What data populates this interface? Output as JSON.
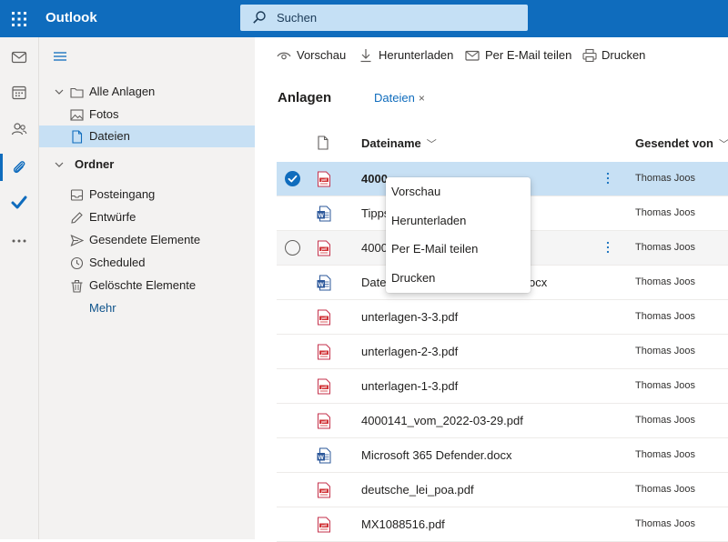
{
  "app": {
    "brand": "Outlook",
    "search_placeholder": "Suchen",
    "accent": "#0f6cbd"
  },
  "rail": {
    "icons": [
      "mail-icon",
      "calendar-icon",
      "people-icon",
      "attachment-icon",
      "todo-check-icon",
      "more-dots-icon"
    ],
    "active": "attachment-icon"
  },
  "folders": {
    "all_attachments": "Alle Anlagen",
    "photos": "Fotos",
    "files": "Dateien",
    "folders_header": "Ordner",
    "inbox": "Posteingang",
    "drafts": "Entwürfe",
    "sent": "Gesendete Elemente",
    "scheduled": "Scheduled",
    "deleted": "Gelöschte Elemente",
    "more": "Mehr"
  },
  "toolbar": {
    "preview": "Vorschau",
    "download": "Herunterladen",
    "share_email": "Per E-Mail teilen",
    "print": "Drucken"
  },
  "main": {
    "title": "Anlagen",
    "filter_chip": "Dateien",
    "filter_chip_close": "×",
    "col_filename": "Dateiname",
    "col_sent_by": "Gesendet von"
  },
  "files": [
    {
      "name": "4000",
      "type": "pdf",
      "sender": "Thomas Joos",
      "state": "selected"
    },
    {
      "name": "Tipps",
      "type": "docx",
      "sender": "Thomas Joos",
      "state": "normal"
    },
    {
      "name": "4000",
      "type": "pdf",
      "sender": "Thomas Joos",
      "state": "hover"
    },
    {
      "name": "Date",
      "name_tail": "ocx",
      "type": "docx",
      "sender": "Thomas Joos",
      "state": "normal"
    },
    {
      "name": "unterlagen-3-3.pdf",
      "type": "pdf",
      "sender": "Thomas Joos",
      "state": "normal"
    },
    {
      "name": "unterlagen-2-3.pdf",
      "type": "pdf",
      "sender": "Thomas Joos",
      "state": "normal"
    },
    {
      "name": "unterlagen-1-3.pdf",
      "type": "pdf",
      "sender": "Thomas Joos",
      "state": "normal"
    },
    {
      "name": "4000141_vom_2022-03-29.pdf",
      "type": "pdf",
      "sender": "Thomas Joos",
      "state": "normal"
    },
    {
      "name": "Microsoft 365 Defender.docx",
      "type": "docx",
      "sender": "Thomas Joos",
      "state": "normal"
    },
    {
      "name": "deutsche_lei_poa.pdf",
      "type": "pdf",
      "sender": "Thomas Joos",
      "state": "normal"
    },
    {
      "name": "MX1088516.pdf",
      "type": "pdf",
      "sender": "Thomas Joos",
      "state": "normal"
    }
  ],
  "context_menu": {
    "items": [
      "Vorschau",
      "Herunterladen",
      "Per E-Mail teilen",
      "Drucken"
    ]
  }
}
